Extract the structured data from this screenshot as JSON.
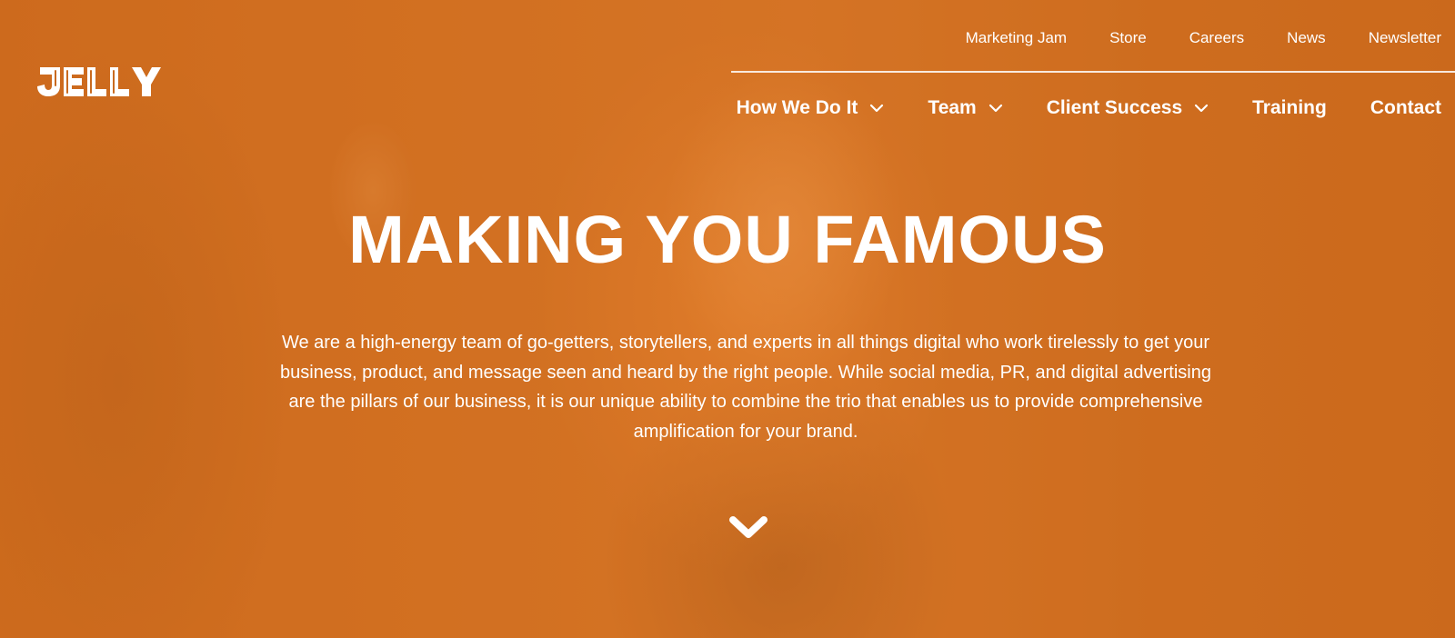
{
  "brand": {
    "logo_text": "JELLY"
  },
  "utility_nav": {
    "items": [
      {
        "label": "Marketing Jam"
      },
      {
        "label": "Store"
      },
      {
        "label": "Careers"
      },
      {
        "label": "News"
      },
      {
        "label": "Newsletter"
      }
    ]
  },
  "main_nav": {
    "items": [
      {
        "label": "How We Do It",
        "has_dropdown": true,
        "icon": "chevron-down-icon"
      },
      {
        "label": "Team",
        "has_dropdown": true,
        "icon": "chevron-down-icon"
      },
      {
        "label": "Client Success",
        "has_dropdown": true,
        "icon": "chevron-down-icon"
      },
      {
        "label": "Training",
        "has_dropdown": false
      },
      {
        "label": "Contact",
        "has_dropdown": false
      }
    ]
  },
  "hero": {
    "title": "MAKING YOU FAMOUS",
    "description": "We are a high-energy team of go-getters, storytellers, and experts in all things digital who work tirelessly to get your business, product, and message seen and heard by the right people. While social media, PR, and digital advertising are the pillars of our business, it is our unique ability to combine the trio that enables us to provide comprehensive amplification for your brand.",
    "scroll_icon": "chevron-down-icon"
  },
  "colors": {
    "background": "#c96a1f",
    "overlay": "#d6701e",
    "text": "#ffffff"
  }
}
